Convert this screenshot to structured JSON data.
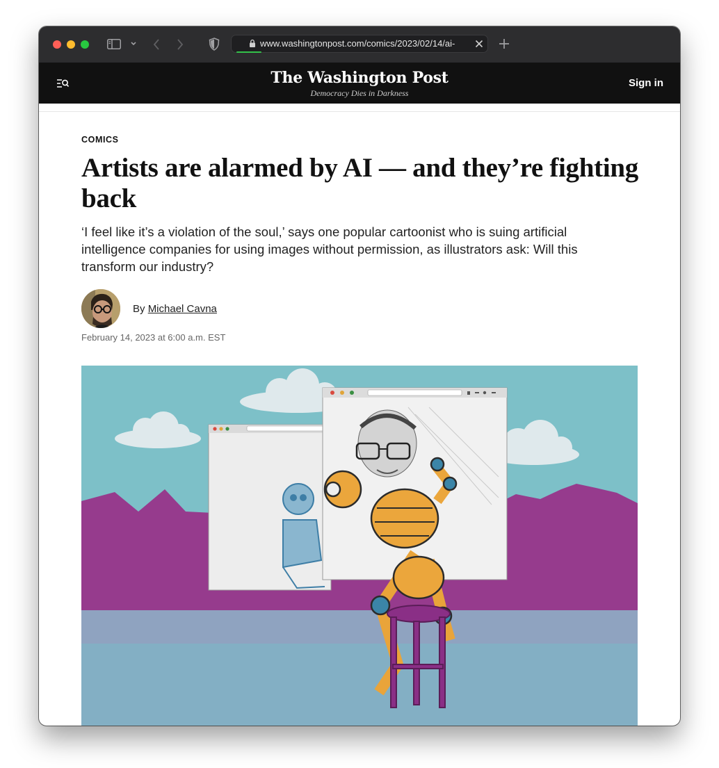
{
  "browser": {
    "url": "www.washingtonpost.com/comics/2023/02/14/ai-",
    "colors": {
      "close": "#ff5f57",
      "minimize": "#febc2e",
      "zoom": "#28c840"
    }
  },
  "header": {
    "masthead": "The Washington Post",
    "tagline": "Democracy Dies in Darkness",
    "sign_in": "Sign in"
  },
  "article": {
    "kicker": "COMICS",
    "headline": "Artists are alarmed by AI — and they’re fighting back",
    "dek": "‘I feel like it’s a violation of the soul,’ says one popular cartoonist who is suing artificial intelligence companies for using images without permission, as illustrators ask: Will this transform our industry?",
    "byline_prefix": "By",
    "author": "Michael Cavna",
    "date": "February 14, 2023 at 6:00 a.m. EST"
  }
}
